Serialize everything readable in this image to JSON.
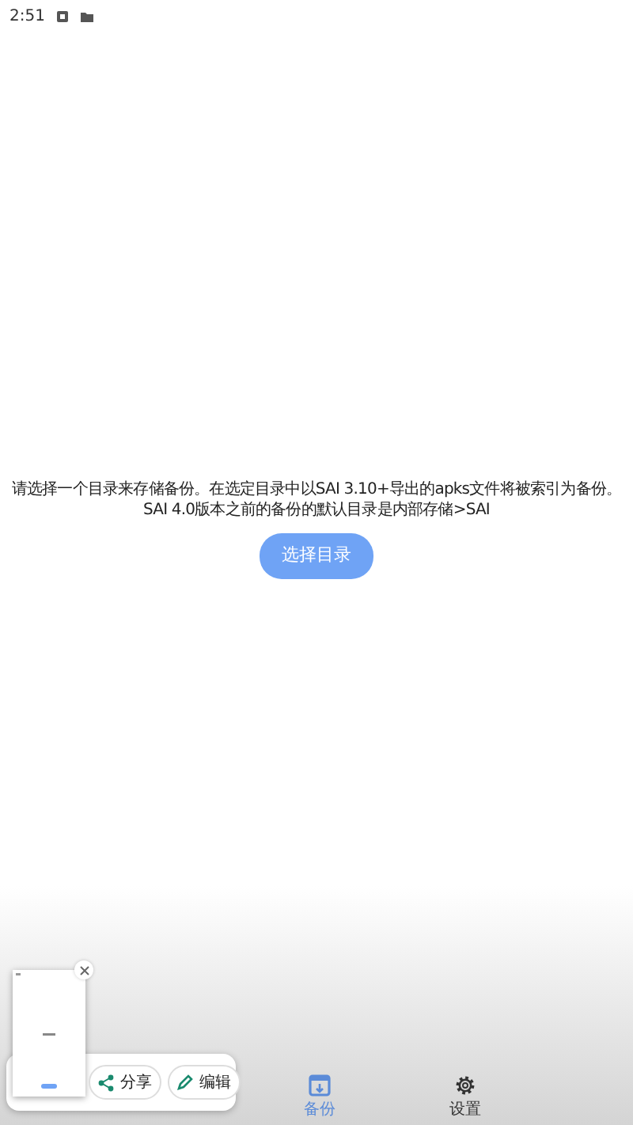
{
  "status_bar": {
    "time": "2:51"
  },
  "message": "请选择一个目录来存储备份。在选定目录中以SAI 3.10+导出的apks文件将被索引为备份。SAI 4.0版本之前的备份的默认目录是内部存储>SAI",
  "choose_button": "选择目录",
  "bottom_nav": [
    {
      "label": "备份",
      "kind": "backup",
      "selected": true
    },
    {
      "label": "设置",
      "kind": "settings",
      "selected": false
    }
  ],
  "screenshot_overlay": {
    "actions": [
      {
        "label": "分享",
        "kind": "share"
      },
      {
        "label": "编辑",
        "kind": "edit"
      }
    ]
  }
}
